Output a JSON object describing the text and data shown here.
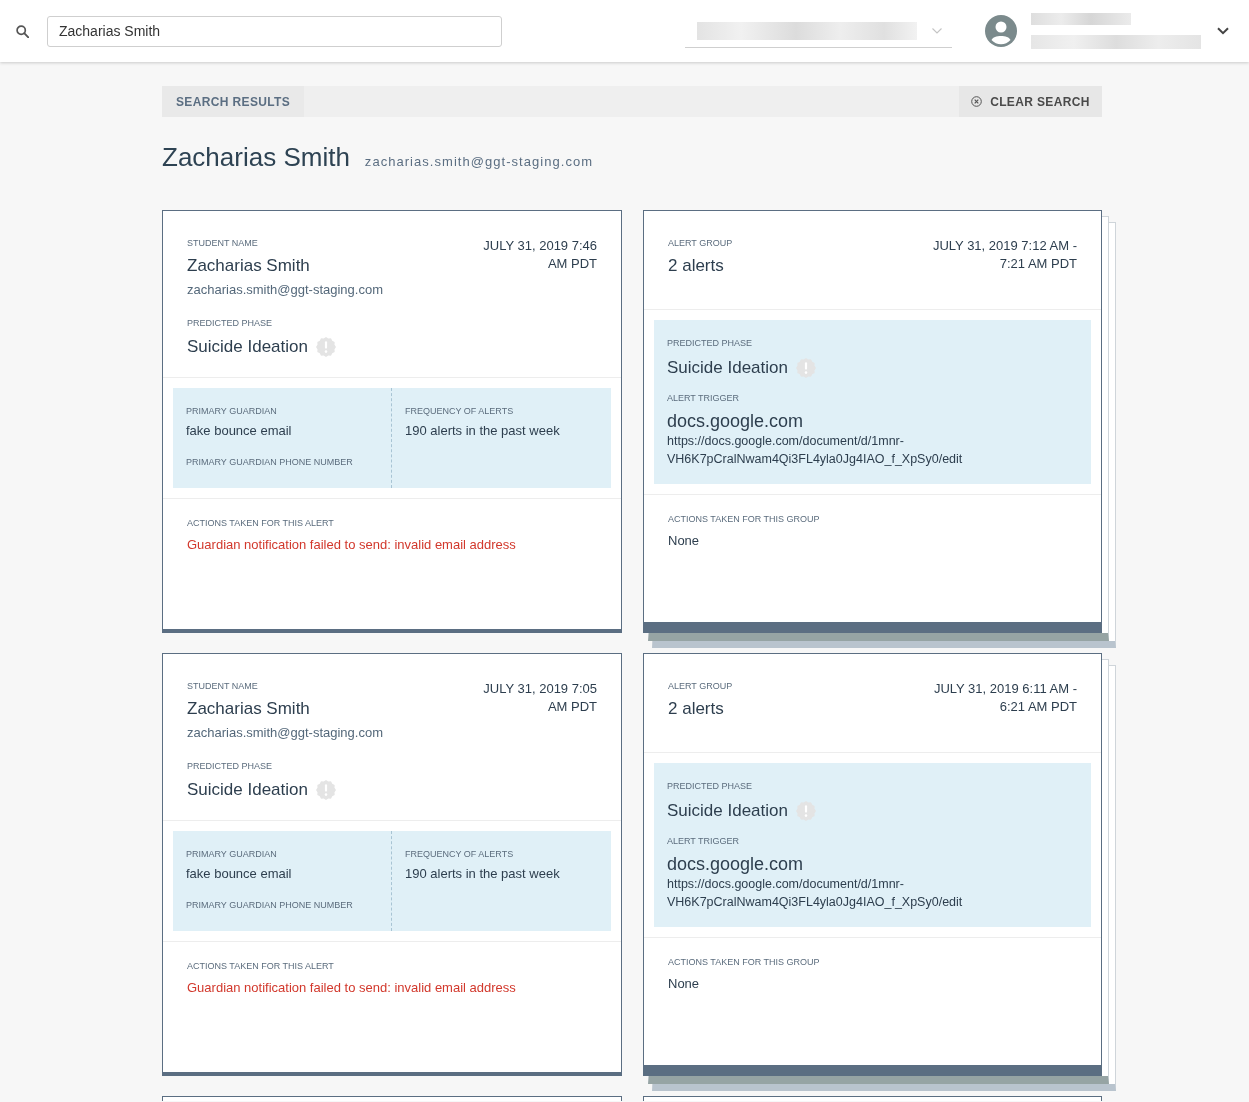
{
  "header": {
    "search": {
      "value": "Zacharias Smith"
    }
  },
  "results_bar": {
    "label": "SEARCH RESULTS",
    "clear_button": "CLEAR SEARCH"
  },
  "student": {
    "name": "Zacharias Smith",
    "email": "zacharias.smith@ggt-staging.com"
  },
  "cards": [
    {
      "kind": "alert",
      "label": "STUDENT NAME",
      "name": "Zacharias Smith",
      "email": "zacharias.smith@ggt-staging.com",
      "timestamp": "JULY 31, 2019 7:46 AM PDT",
      "phase_label": "PREDICTED PHASE",
      "phase": "Suicide Ideation",
      "guardian_label": "PRIMARY GUARDIAN",
      "guardian": "fake bounce email",
      "phone_label": "PRIMARY GUARDIAN PHONE NUMBER",
      "frequency_label": "FREQUENCY OF ALERTS",
      "frequency": "190 alerts in the past week",
      "actions_label": "ACTIONS TAKEN FOR THIS ALERT",
      "actions": "Guardian notification failed to send: invalid email address",
      "actions_error": true
    },
    {
      "kind": "group",
      "label": "ALERT GROUP",
      "count": "2 alerts",
      "timestamp": "JULY 31, 2019 7:12 AM - 7:21 AM PDT",
      "phase_label": "PREDICTED PHASE",
      "phase": "Suicide Ideation",
      "trigger_label": "ALERT TRIGGER",
      "trigger_domain": "docs.google.com",
      "trigger_url": "https://docs.google.com/document/d/1mnr-VH6K7pCralNwam4Qi3FL4yla0Jg4IAO_f_XpSy0/edit",
      "actions_label": "ACTIONS TAKEN FOR THIS GROUP",
      "actions": "None",
      "actions_error": false
    },
    {
      "kind": "alert",
      "label": "STUDENT NAME",
      "name": "Zacharias Smith",
      "email": "zacharias.smith@ggt-staging.com",
      "timestamp": "JULY 31, 2019 7:05 AM PDT",
      "phase_label": "PREDICTED PHASE",
      "phase": "Suicide Ideation",
      "guardian_label": "PRIMARY GUARDIAN",
      "guardian": "fake bounce email",
      "phone_label": "PRIMARY GUARDIAN PHONE NUMBER",
      "frequency_label": "FREQUENCY OF ALERTS",
      "frequency": "190 alerts in the past week",
      "actions_label": "ACTIONS TAKEN FOR THIS ALERT",
      "actions": "Guardian notification failed to send: invalid email address",
      "actions_error": true
    },
    {
      "kind": "group",
      "label": "ALERT GROUP",
      "count": "2 alerts",
      "timestamp": "JULY 31, 2019 6:11 AM - 6:21 AM PDT",
      "phase_label": "PREDICTED PHASE",
      "phase": "Suicide Ideation",
      "trigger_label": "ALERT TRIGGER",
      "trigger_domain": "docs.google.com",
      "trigger_url": "https://docs.google.com/document/d/1mnr-VH6K7pCralNwam4Qi3FL4yla0Jg4IAO_f_XpSy0/edit",
      "actions_label": "ACTIONS TAKEN FOR THIS GROUP",
      "actions": "None",
      "actions_error": false
    },
    {
      "kind": "alert"
    },
    {
      "kind": "group"
    }
  ]
}
